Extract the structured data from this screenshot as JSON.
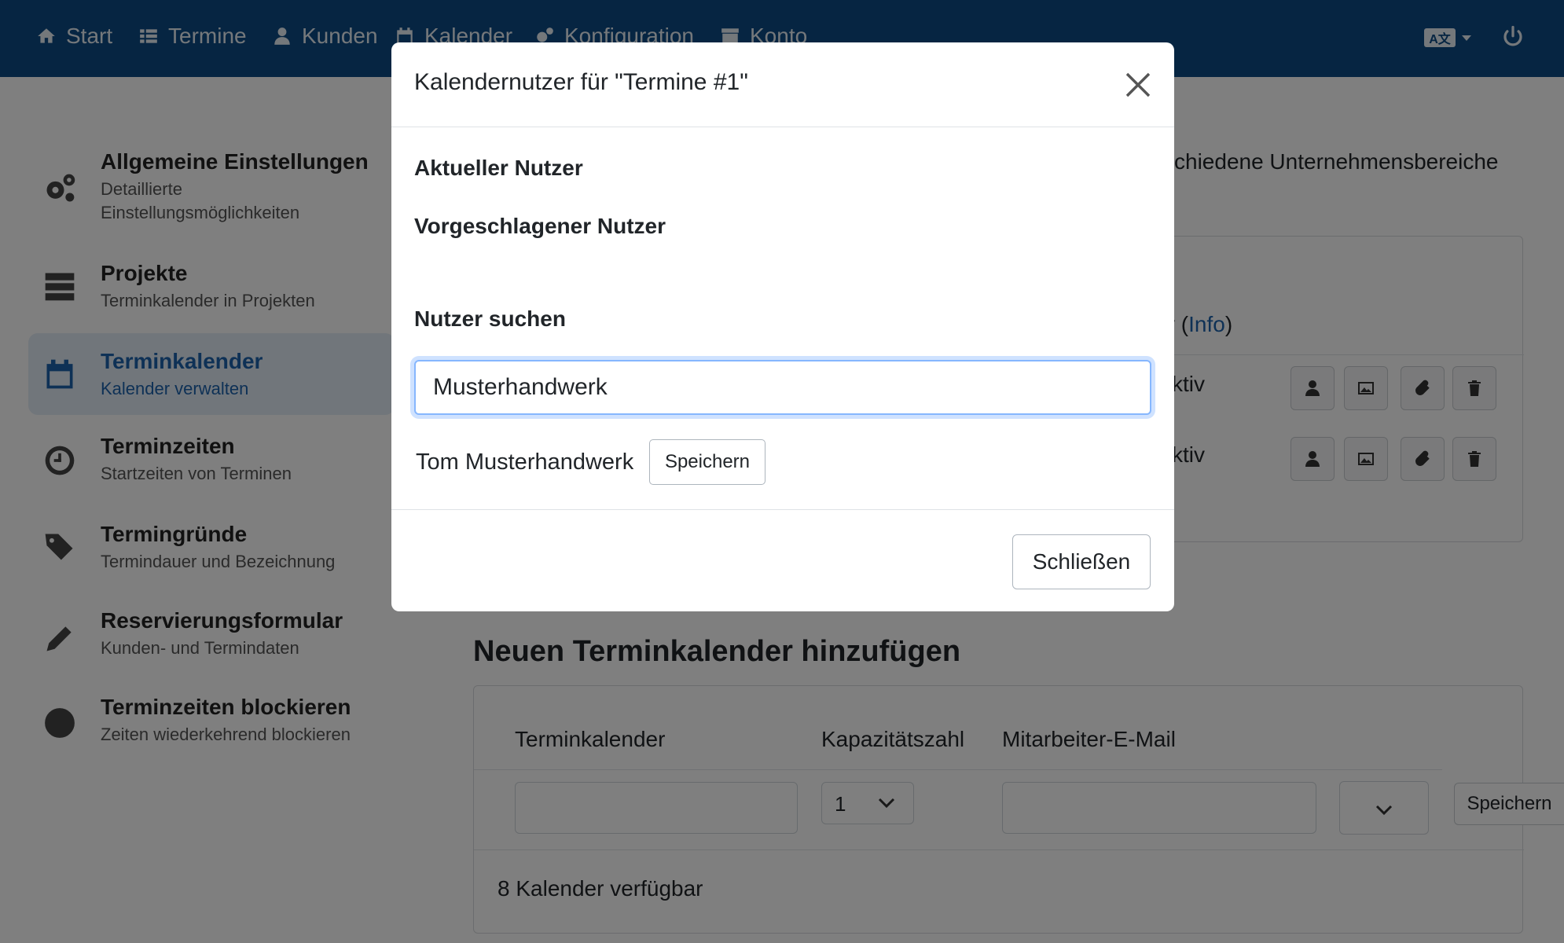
{
  "nav": {
    "items": [
      {
        "label": "Start",
        "icon": "home-icon"
      },
      {
        "label": "Termine",
        "icon": "list-icon"
      },
      {
        "label": "Kunden",
        "icon": "user-icon"
      },
      {
        "label": "Kalender",
        "icon": "calendar-icon"
      },
      {
        "label": "Konfiguration",
        "icon": "gears-icon"
      },
      {
        "label": "Konto",
        "icon": "archive-icon"
      }
    ],
    "language_icon": "language-icon",
    "power_icon": "power-icon"
  },
  "sidebar": {
    "items": [
      {
        "title": "Allgemeine Einstellungen",
        "sub": "Detaillierte Einstellungsmöglichkeiten",
        "icon": "gears-icon"
      },
      {
        "title": "Projekte",
        "sub": "Terminkalender in Projekten",
        "icon": "server-icon"
      },
      {
        "title": "Terminkalender",
        "sub": "Kalender verwalten",
        "icon": "calendar-icon",
        "active": true
      },
      {
        "title": "Terminzeiten",
        "sub": "Startzeiten von Terminen",
        "icon": "clock-icon"
      },
      {
        "title": "Termingründe",
        "sub": "Termindauer und Bezeichnung",
        "icon": "tags-icon"
      },
      {
        "title": "Reservierungsformular",
        "sub": "Kunden- und Termindaten",
        "icon": "pencil-icon"
      },
      {
        "title": "Terminzeiten blockieren",
        "sub": "Zeiten wiederkehrend blockieren",
        "icon": "ban-icon"
      }
    ]
  },
  "main": {
    "intro_fragment": "schiedene Unternehmensbereiche",
    "table_header_fragment": "y (",
    "table_header_link": "Info",
    "table_header_close": ")",
    "row_status": [
      "ktiv",
      "ktiv"
    ],
    "add_title": "Neuen Terminkalender hinzufügen",
    "add_form": {
      "col_calendar": "Terminkalender",
      "col_capacity": "Kapazitätszahl",
      "col_email": "Mitarbeiter-E-Mail",
      "capacity_value": "1",
      "save_label": "Speichern",
      "available": "8 Kalender verfügbar"
    }
  },
  "modal": {
    "title": "Kalendernutzer für \"Termine #1\"",
    "current_user_label": "Aktueller Nutzer",
    "suggested_user_label": "Vorgeschlagener Nutzer",
    "search_label": "Nutzer suchen",
    "search_value": "Musterhandwerk",
    "result_name": "Tom Musterhandwerk",
    "result_save": "Speichern",
    "close_label": "Schließen"
  }
}
